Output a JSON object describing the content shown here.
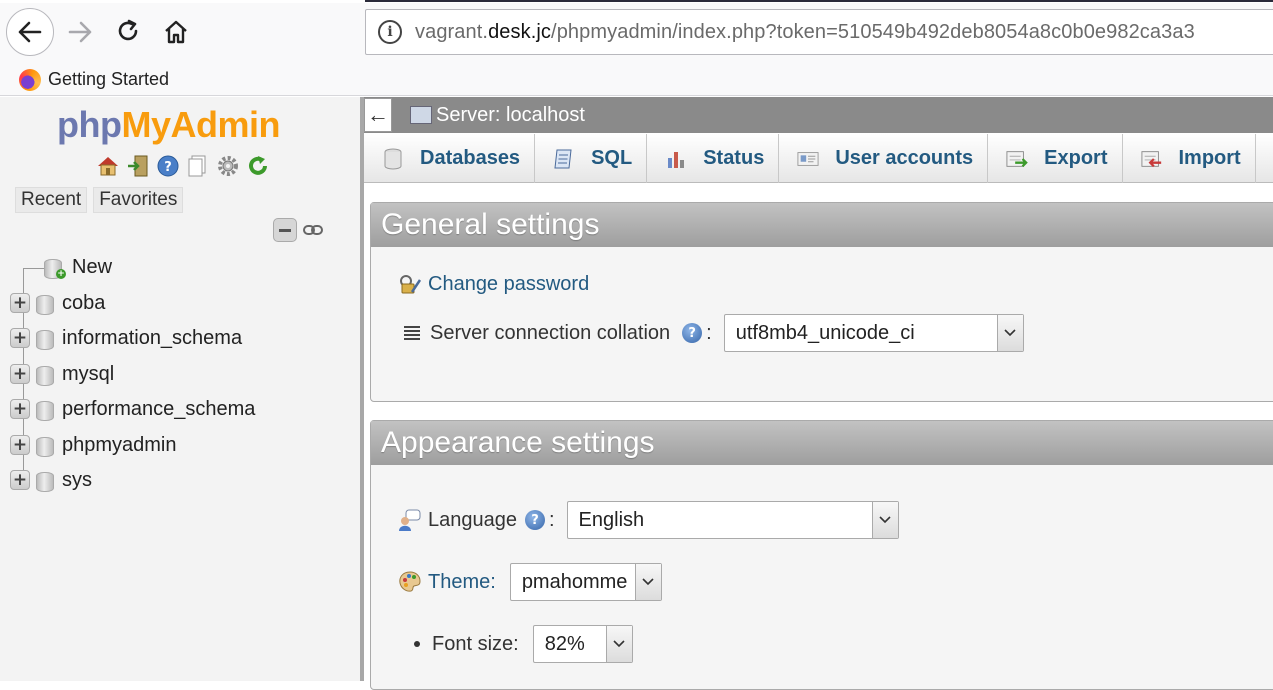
{
  "browser": {
    "url_prefix": "vagrant.",
    "url_domain": "desk.jc",
    "url_path": "/phpmyadmin/index.php?token=510549b492deb8054a8c0b0e982ca3a3",
    "bookmark": "Getting Started"
  },
  "nav": {
    "logo_php": "php",
    "logo_myadmin": "MyAdmin",
    "tabs": [
      "Recent",
      "Favorites"
    ],
    "new_label": "New",
    "databases": [
      "coba",
      "information_schema",
      "mysql",
      "performance_schema",
      "phpmyadmin",
      "sys"
    ]
  },
  "main": {
    "server_title": "Server: localhost",
    "tabs": [
      "Databases",
      "SQL",
      "Status",
      "User accounts",
      "Export",
      "Import"
    ]
  },
  "general": {
    "title": "General settings",
    "change_password": "Change password",
    "collation_label": "Server connection collation",
    "collation_value": "utf8mb4_unicode_ci"
  },
  "appearance": {
    "title": "Appearance settings",
    "language_label": "Language",
    "language_value": "English",
    "theme_label": "Theme:",
    "theme_value": "pmahomme",
    "fontsize_label": "Font size:",
    "fontsize_value": "82%"
  },
  "colors": {
    "link": "#235a81",
    "logo_php": "#6c78af",
    "logo_myadmin": "#f89c0e",
    "header_gray": "#8a8a8a"
  }
}
